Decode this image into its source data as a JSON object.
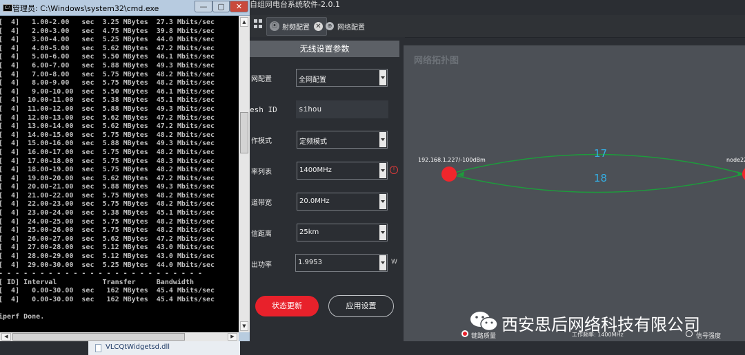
{
  "cmd": {
    "title": "管理员: C:\\Windows\\system32\\cmd.exe",
    "icon_glyph": "C:\\",
    "controls": {
      "minimize": "—",
      "maximize": "▢",
      "close": "✕"
    },
    "console_lines": [
      "[  4]   1.00-2.00   sec  3.25 MBytes  27.3 Mbits/sec",
      "[  4]   2.00-3.00   sec  4.75 MBytes  39.8 Mbits/sec",
      "[  4]   3.00-4.00   sec  5.25 MBytes  44.0 Mbits/sec",
      "[  4]   4.00-5.00   sec  5.62 MBytes  47.2 Mbits/sec",
      "[  4]   5.00-6.00   sec  5.50 MBytes  46.1 Mbits/sec",
      "[  4]   6.00-7.00   sec  5.88 MBytes  49.3 Mbits/sec",
      "[  4]   7.00-8.00   sec  5.75 MBytes  48.2 Mbits/sec",
      "[  4]   8.00-9.00   sec  5.75 MBytes  48.2 Mbits/sec",
      "[  4]   9.00-10.00  sec  5.50 MBytes  46.1 Mbits/sec",
      "[  4]  10.00-11.00  sec  5.38 MBytes  45.1 Mbits/sec",
      "[  4]  11.00-12.00  sec  5.88 MBytes  49.3 Mbits/sec",
      "[  4]  12.00-13.00  sec  5.62 MBytes  47.2 Mbits/sec",
      "[  4]  13.00-14.00  sec  5.62 MBytes  47.2 Mbits/sec",
      "[  4]  14.00-15.00  sec  5.75 MBytes  48.2 Mbits/sec",
      "[  4]  15.00-16.00  sec  5.88 MBytes  49.3 Mbits/sec",
      "[  4]  16.00-17.00  sec  5.75 MBytes  48.2 Mbits/sec",
      "[  4]  17.00-18.00  sec  5.75 MBytes  48.3 Mbits/sec",
      "[  4]  18.00-19.00  sec  5.75 MBytes  48.2 Mbits/sec",
      "[  4]  19.00-20.00  sec  5.62 MBytes  47.2 Mbits/sec",
      "[  4]  20.00-21.00  sec  5.88 MBytes  49.3 Mbits/sec",
      "[  4]  21.00-22.00  sec  5.75 MBytes  48.2 Mbits/sec",
      "[  4]  22.00-23.00  sec  5.75 MBytes  48.2 Mbits/sec",
      "[  4]  23.00-24.00  sec  5.38 MBytes  45.1 Mbits/sec",
      "[  4]  24.00-25.00  sec  5.75 MBytes  48.2 Mbits/sec",
      "[  4]  25.00-26.00  sec  5.75 MBytes  48.2 Mbits/sec",
      "[  4]  26.00-27.00  sec  5.62 MBytes  47.2 Mbits/sec",
      "[  4]  27.00-28.00  sec  5.12 MBytes  43.0 Mbits/sec",
      "[  4]  28.00-29.00  sec  5.12 MBytes  43.0 Mbits/sec",
      "[  4]  29.00-30.00  sec  5.25 MBytes  44.0 Mbits/sec",
      "- - - - - - - - - - - - - - - - - - - - - - - - -",
      "[ ID] Interval           Transfer     Bandwidth",
      "[  4]   0.00-30.00  sec   162 MBytes  45.4 Mbits/sec",
      "[  4]   0.00-30.00  sec   162 MBytes  45.4 Mbits/sec",
      "",
      "iperf Done."
    ]
  },
  "taskbar_file": {
    "name": "VLCQtWidgetsd.dll"
  },
  "app": {
    "title": "自组网电台系统软件-2.0.1",
    "tabs": [
      {
        "label": "射频配置",
        "icon": "⦿",
        "close": "✕"
      },
      {
        "label": "网络配置",
        "icon": "⊕"
      }
    ]
  },
  "wireless": {
    "header": "无线设置参数",
    "fields": {
      "network_config": {
        "label": "网配置",
        "value": "全网配置"
      },
      "mesh_id": {
        "label": "esh ID",
        "value": "sihou"
      },
      "work_mode": {
        "label": "作模式",
        "value": "定频模式"
      },
      "freq_list": {
        "label": "率列表",
        "value": "1400MHz"
      },
      "bandwidth": {
        "label": "道带宽",
        "value": "20.0MHz"
      },
      "distance": {
        "label": "信距离",
        "value": "25km"
      },
      "power": {
        "label": "出功率",
        "value": "1.9953",
        "unit": "W"
      }
    },
    "status_button": "状态更新",
    "apply_button": "应用设置"
  },
  "topology": {
    "title": "网络拓扑图",
    "node_a_label": "192.168.1.227/-100dBm",
    "node_b_label": "node22",
    "link_upper": "17",
    "link_lower": "18",
    "colors": {
      "node": "#f0262c",
      "link": "#1e9a3c",
      "link_label": "#35aee2"
    }
  },
  "watermark": "西安思后网络科技有限公司",
  "legend": {
    "link_state": "链路质量",
    "work_freq": "工作频率: 1400MHz",
    "signal": "信号强度"
  }
}
